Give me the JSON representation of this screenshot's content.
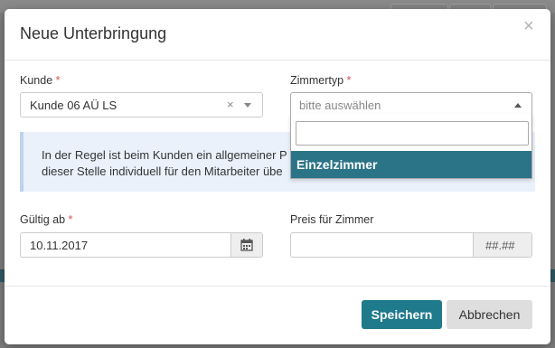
{
  "modal": {
    "title": "Neue Unterbringung",
    "close_symbol": "×"
  },
  "kunde": {
    "label": "Kunde",
    "required_mark": "*",
    "value": "Kunde 06 AÜ LS",
    "clear_symbol": "×"
  },
  "zimmertyp": {
    "label": "Zimmertyp",
    "required_mark": "*",
    "placeholder": "bitte auswählen",
    "dropdown": {
      "search_value": "",
      "options": [
        "Einzelzimmer"
      ],
      "highlighted": "Einzelzimmer"
    }
  },
  "info": {
    "line1": "In der Regel ist beim Kunden ein allgemeiner P",
    "line2": "dieser Stelle individuell für den Mitarbeiter übe"
  },
  "gueltig_ab": {
    "label": "Gültig ab",
    "required_mark": "*",
    "value": "10.11.2017",
    "icon": "calendar-icon"
  },
  "preis": {
    "label": "Preis für Zimmer",
    "value": "",
    "addon": "##.##"
  },
  "footer": {
    "save_label": "Speichern",
    "cancel_label": "Abbrechen"
  },
  "colors": {
    "primary": "#1f7a8c",
    "highlight": "#2b7487",
    "required": "#d9534f",
    "info_bg": "#eaf1fb"
  }
}
